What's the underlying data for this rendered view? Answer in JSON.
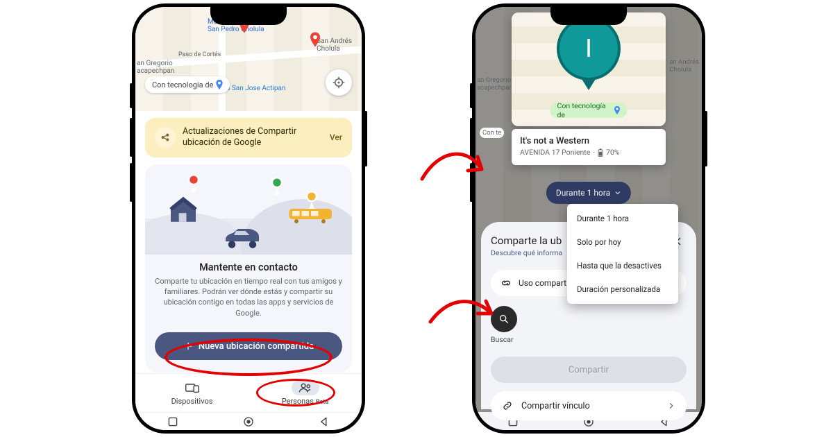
{
  "left": {
    "tech_chip": "Con tecnología de",
    "map_labels": {
      "market": "Mercado municipal\nSan Pedro Cholula",
      "andres": "San Andrés\nCholula",
      "gregorio": "an Gregorio\nacapechpan",
      "paso": "Paso de Cortés",
      "tienda": "ienda San Jose Actipan"
    },
    "banner": {
      "text": "Actualizaciones de Compartir ubicación de Google",
      "see": "Ver"
    },
    "card": {
      "title": "Mantente en contacto",
      "desc": "Comparte tu ubicación en tiempo real con tus amigos y familiares. Podrán ver dónde estás y compartir su ubicación contigo en todas las apps y servicios de Google.",
      "cta": "Nueva ubicación compartida"
    },
    "tabs": {
      "devices": "Dispositivos",
      "people": "Personas",
      "beta": "Beta"
    }
  },
  "right": {
    "side_label_1": "an Andrés\nCholula",
    "side_label_2": "an Gregorio\nacapechpan",
    "side_label_3": "Con te",
    "tech_chip": "Con tecnología de",
    "avatar_initial": "I",
    "person": {
      "name": "It's not a Western",
      "addr": "AVENIDA 17 Poniente",
      "battery": "70%"
    },
    "duration_chip": "Durante 1 hora",
    "dropdown": {
      "opt1": "Durante 1 hora",
      "opt2": "Solo por hoy",
      "opt3": "Hasta que la desactives",
      "opt4": "Duración personalizada"
    },
    "sheet": {
      "title": "Comparte la ub",
      "subtitle": "Descubre qué informa",
      "shared_use": "Uso compart",
      "search": "Buscar",
      "share": "Compartir",
      "share_link": "Compartir vínculo"
    }
  }
}
